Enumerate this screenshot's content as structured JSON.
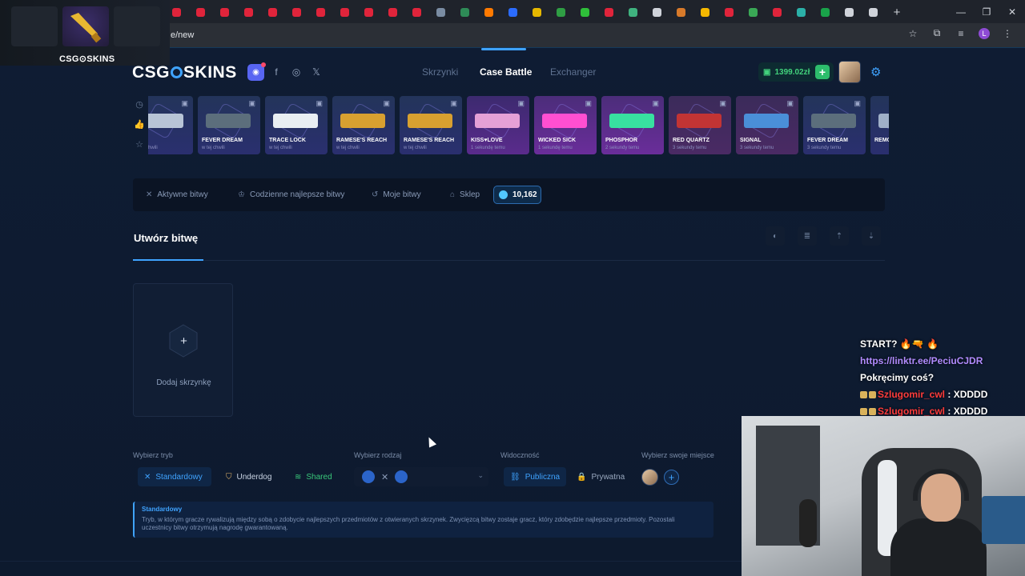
{
  "browser": {
    "url": "e/new",
    "tab_favicon_colors": [
      "#e0243b",
      "#e0243b",
      "#e0243b",
      "#e0243b",
      "#e0243b",
      "#e0243b",
      "#e0243b",
      "#e0243b",
      "#e0243b",
      "#e0243b",
      "#e0243b",
      "#7a8ca3",
      "#2e8b57",
      "#ff7a00",
      "#2b6cff",
      "#e6b800",
      "#2f9e44",
      "#2fbf3a",
      "#e0243b",
      "#3fb27f",
      "#cfd3da",
      "#d87a2a",
      "#f5b800",
      "#e0243b",
      "#3aa856",
      "#e0243b",
      "#2bb0a8",
      "#19a34a",
      "#cfd3da",
      "#cfd3da"
    ],
    "new_tab": "+",
    "profile_initial": "L"
  },
  "overlay": {
    "brand": "CSG⊙SKINS"
  },
  "header": {
    "logo_left": "CSG",
    "logo_right": "SKINS",
    "nav": [
      {
        "label": "Skrzynki"
      },
      {
        "label": "Case Battle"
      },
      {
        "label": "Exchanger"
      }
    ],
    "balance": "1399.02zł",
    "colors": {
      "accent": "#3fa3ff",
      "balance": "#42d27c"
    }
  },
  "drops": [
    {
      "name": "",
      "time": "w tej chwili",
      "color": "#b8c4d6",
      "style": "blue"
    },
    {
      "name": "FEVER DREAM",
      "time": "w tej chwili",
      "color": "#5c6e7c",
      "style": "blue"
    },
    {
      "name": "TRACE LOCK",
      "time": "w tej chwili",
      "color": "#e9eef2",
      "style": "blue"
    },
    {
      "name": "RAMESE'S REACH",
      "time": "w tej chwili",
      "color": "#d8a030",
      "style": "blue"
    },
    {
      "name": "RAMESE'S REACH",
      "time": "w tej chwili",
      "color": "#d8a030",
      "style": "blue"
    },
    {
      "name": "KISS♥LOVE",
      "time": "1 sekundę temu",
      "color": "#e5a0d6",
      "style": "purple"
    },
    {
      "name": "WICKED SICK",
      "time": "1 sekundę temu",
      "color": "#ff4fd1",
      "style": "pink"
    },
    {
      "name": "PHOSPHOR",
      "time": "2 sekundy temu",
      "color": "#38e0a0",
      "style": "pink"
    },
    {
      "name": "RED QUARTZ",
      "time": "3 sekundy temu",
      "color": "#c23434",
      "style": "red"
    },
    {
      "name": "SIGNAL",
      "time": "3 sekundy temu",
      "color": "#4a8fd8",
      "style": "red"
    },
    {
      "name": "FEVER DREAM",
      "time": "3 sekundy temu",
      "color": "#5c6e7c",
      "style": "blue"
    },
    {
      "name": "REMO",
      "time": "",
      "color": "#a0b0c8",
      "style": "blue"
    }
  ],
  "battle_menu": {
    "items": [
      {
        "label": "Aktywne bitwy",
        "icon": "swords-icon"
      },
      {
        "label": "Codzienne najlepsze bitwy",
        "icon": "trophy-icon"
      },
      {
        "label": "Moje bitwy",
        "icon": "history-icon"
      },
      {
        "label": "Sklep",
        "icon": "shop-icon"
      }
    ],
    "coins": "10,162"
  },
  "create": {
    "title": "Utwórz bitwę",
    "add_case": "Dodaj skrzynkę",
    "add_symbol": "+"
  },
  "options": {
    "mode_label": "Wybierz tryb",
    "modes": [
      {
        "label": "Standardowy"
      },
      {
        "label": "Underdog"
      },
      {
        "label": "Shared"
      }
    ],
    "type_label": "Wybierz rodzaj",
    "type_vs": "✕",
    "visibility_label": "Widoczność",
    "visibility": [
      {
        "label": "Publiczna"
      },
      {
        "label": "Prywatna"
      }
    ],
    "seat_label": "Wybierz swoje miejsce",
    "seat_add": "+"
  },
  "info": {
    "heading": "Standardowy",
    "text": "Tryb, w którym gracze rywalizują między sobą o zdobycie najlepszych przedmiotów z otwieranych skrzynek. Zwycięzcą bitwy zostaje gracz, który zdobędzie najlepsze przedmioty. Pozostali uczestnicy bitwy otrzymują nagrodę gwarantowaną."
  },
  "chat": {
    "lines": [
      {
        "text": "START? 🔥🔫 🔥"
      },
      {
        "text": "https://linktr.ee/PeciuCJDR",
        "kind": "link"
      },
      {
        "text": "Pokręcimy coś?"
      },
      {
        "user": "Szlugomir_cwl",
        "msg": " : XDDDD"
      },
      {
        "user": "Szlugomir_cwl",
        "msg": " : XDDDD"
      }
    ]
  }
}
